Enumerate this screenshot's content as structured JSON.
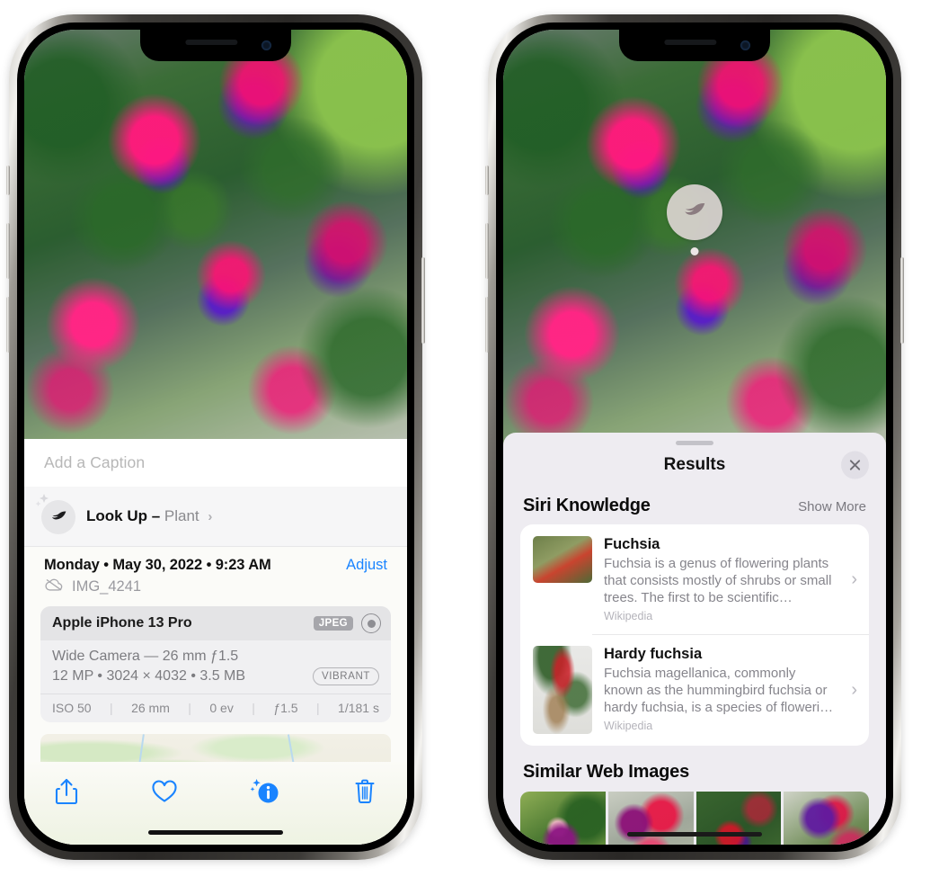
{
  "left_phone": {
    "caption": {
      "placeholder": "Add a Caption",
      "value": ""
    },
    "lookup": {
      "label": "Look Up –",
      "subject": "Plant",
      "chevron": "›",
      "icon": "leaf-icon"
    },
    "datetime": "Monday • May 30, 2022 • 9:23 AM",
    "adjust_label": "Adjust",
    "filename": "IMG_4241",
    "exif": {
      "device": "Apple iPhone 13 Pro",
      "format_badge": "JPEG",
      "lens": "Wide Camera — 26 mm ƒ1.5",
      "specs": "12 MP • 3024 × 4032 • 3.5 MB",
      "style_chip": "VIBRANT",
      "stats": [
        "ISO 50",
        "26 mm",
        "0 ev",
        "ƒ1.5",
        "1/181 s"
      ]
    },
    "toolbar": [
      {
        "name": "share-button",
        "icon": "share-icon"
      },
      {
        "name": "favorite-button",
        "icon": "heart-icon"
      },
      {
        "name": "info-button",
        "icon": "info-sparkle-icon"
      },
      {
        "name": "delete-button",
        "icon": "trash-icon"
      }
    ]
  },
  "right_phone": {
    "pin": {
      "icon": "leaf-icon"
    },
    "sheet_title": "Results",
    "close_icon": "close-icon",
    "sections": [
      {
        "title": "Siri Knowledge",
        "action": "Show More",
        "items": [
          {
            "title": "Fuchsia",
            "description": "Fuchsia is a genus of flowering plants that consists mostly of shrubs or small trees. The first to be scientific…",
            "source": "Wikipedia",
            "chevron": "›"
          },
          {
            "title": "Hardy fuchsia",
            "description": "Fuchsia magellanica, commonly known as the hummingbird fuchsia or hardy fuchsia, is a species of floweri…",
            "source": "Wikipedia",
            "chevron": "›"
          }
        ]
      },
      {
        "title": "Similar Web Images",
        "thumbnails": [
          {
            "name": "web-image-1"
          },
          {
            "name": "web-image-2"
          },
          {
            "name": "web-image-3"
          },
          {
            "name": "web-image-4"
          }
        ]
      }
    ]
  },
  "colors": {
    "accent_blue": "#1a84ff",
    "sheet_background": "#eeecf1",
    "card_white": "#ffffff",
    "secondary_text": "#86858c",
    "exif_background": "#f0f0f2"
  }
}
